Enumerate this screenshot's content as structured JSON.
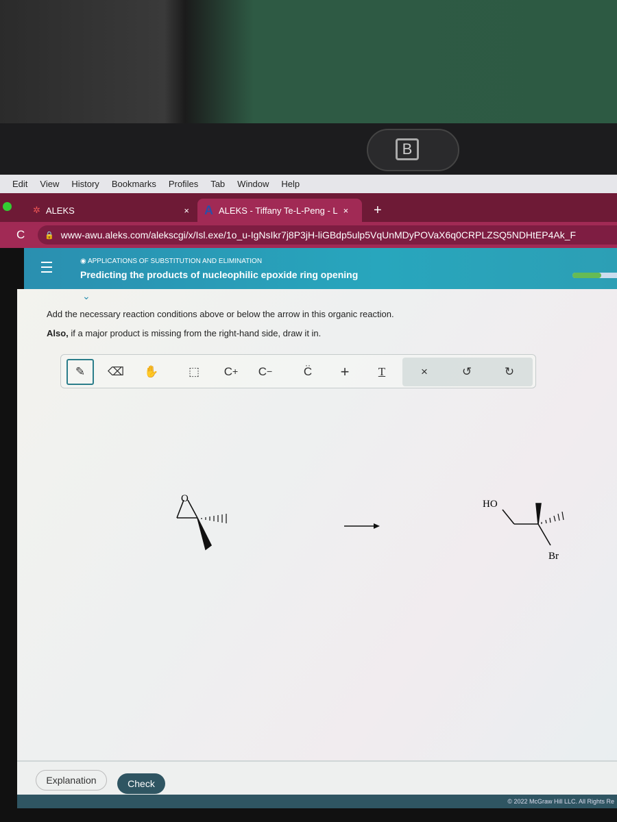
{
  "menubar": [
    "Edit",
    "View",
    "History",
    "Bookmarks",
    "Profiles",
    "Tab",
    "Window",
    "Help"
  ],
  "tabs": [
    {
      "label": "ALEKS",
      "close": "×"
    },
    {
      "label": "ALEKS - Tiffany Te-L-Peng - L",
      "close": "×"
    }
  ],
  "new_tab": "+",
  "url": "www-awu.aleks.com/alekscgi/x/Isl.exe/1o_u-IgNsIkr7j8P3jH-liGBdp5ulp5VqUnMDyPOVaX6q0CRPLZSQ5NDHtEP4Ak_F",
  "header": {
    "category": "APPLICATIONS OF SUBSTITUTION AND ELIMINATION",
    "title": "Predicting the products of nucleophilic epoxide ring opening",
    "progress": 0.6
  },
  "instructions": {
    "line1": "Add the necessary reaction conditions above or below the arrow in this organic reaction.",
    "line2_bold": "Also,",
    "line2": " if a major product is missing from the right-hand side, draw it in."
  },
  "toolbar": {
    "tools": [
      "pencil-icon",
      "eraser-icon",
      "hand-icon",
      "select-icon"
    ],
    "cplus": "C",
    "cminus": "C",
    "lonepair": "C",
    "plus": "+",
    "text": "T",
    "clear": "×",
    "undo": "↺",
    "redo": "↻"
  },
  "reaction": {
    "reactant_O": "O",
    "product_HO": "HO",
    "product_Br": "Br"
  },
  "footer": {
    "explanation": "Explanation",
    "check": "Check",
    "copyright": "© 2022 McGraw Hill LLC. All Rights Re"
  },
  "colors": {
    "tabbar": "#6e1a36",
    "header": "#28a6bd",
    "check": "#2f5562"
  }
}
